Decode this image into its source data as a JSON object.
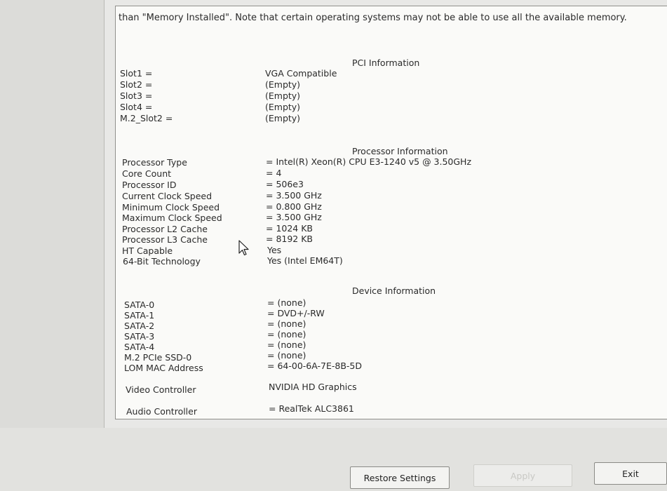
{
  "intro_text": "than \"Memory Installed\". Note that certain operating systems may not be able to use all the available memory.",
  "pci": {
    "title": "PCI Information",
    "rows": [
      {
        "label": "Slot1 =",
        "value": "VGA Compatible"
      },
      {
        "label": "Slot2 =",
        "value": "(Empty)"
      },
      {
        "label": "Slot3 =",
        "value": "(Empty)"
      },
      {
        "label": "Slot4 =",
        "value": "(Empty)"
      },
      {
        "label": "M.2_Slot2 =",
        "value": "(Empty)"
      }
    ]
  },
  "processor": {
    "title": "Processor Information",
    "rows": [
      {
        "label": "Processor Type",
        "value": "= Intel(R) Xeon(R) CPU E3-1240 v5 @ 3.50GHz"
      },
      {
        "label": "Core Count",
        "value": "= 4"
      },
      {
        "label": "Processor ID",
        "value": "= 506e3"
      },
      {
        "label": "Current Clock Speed",
        "value": "= 3.500 GHz"
      },
      {
        "label": "Minimum Clock Speed",
        "value": "= 0.800 GHz"
      },
      {
        "label": "Maximum Clock Speed",
        "value": "= 3.500 GHz"
      },
      {
        "label": "Processor L2 Cache",
        "value": "= 1024 KB"
      },
      {
        "label": "Processor L3 Cache",
        "value": "= 8192 KB"
      },
      {
        "label": "HT Capable",
        "value": "Yes"
      },
      {
        "label": "64-Bit Technology",
        "value": "Yes (Intel EM64T)"
      }
    ]
  },
  "device": {
    "title": "Device Information",
    "rows": [
      {
        "label": "SATA-0",
        "value": "= (none)"
      },
      {
        "label": "SATA-1",
        "value": "= DVD+/-RW"
      },
      {
        "label": "SATA-2",
        "value": "= (none)"
      },
      {
        "label": "SATA-3",
        "value": "= (none)"
      },
      {
        "label": "SATA-4",
        "value": "= (none)"
      },
      {
        "label": "M.2 PCIe SSD-0",
        "value": "= (none)"
      },
      {
        "label": "LOM MAC Address",
        "value": "= 64-00-6A-7E-8B-5D"
      },
      {
        "label": "Video Controller",
        "value": "NVIDIA HD Graphics"
      },
      {
        "label": "Audio Controller",
        "value": "= RealTek ALC3861"
      }
    ]
  },
  "buttons": {
    "restore": "Restore Settings",
    "apply": "Apply",
    "exit": "Exit"
  }
}
